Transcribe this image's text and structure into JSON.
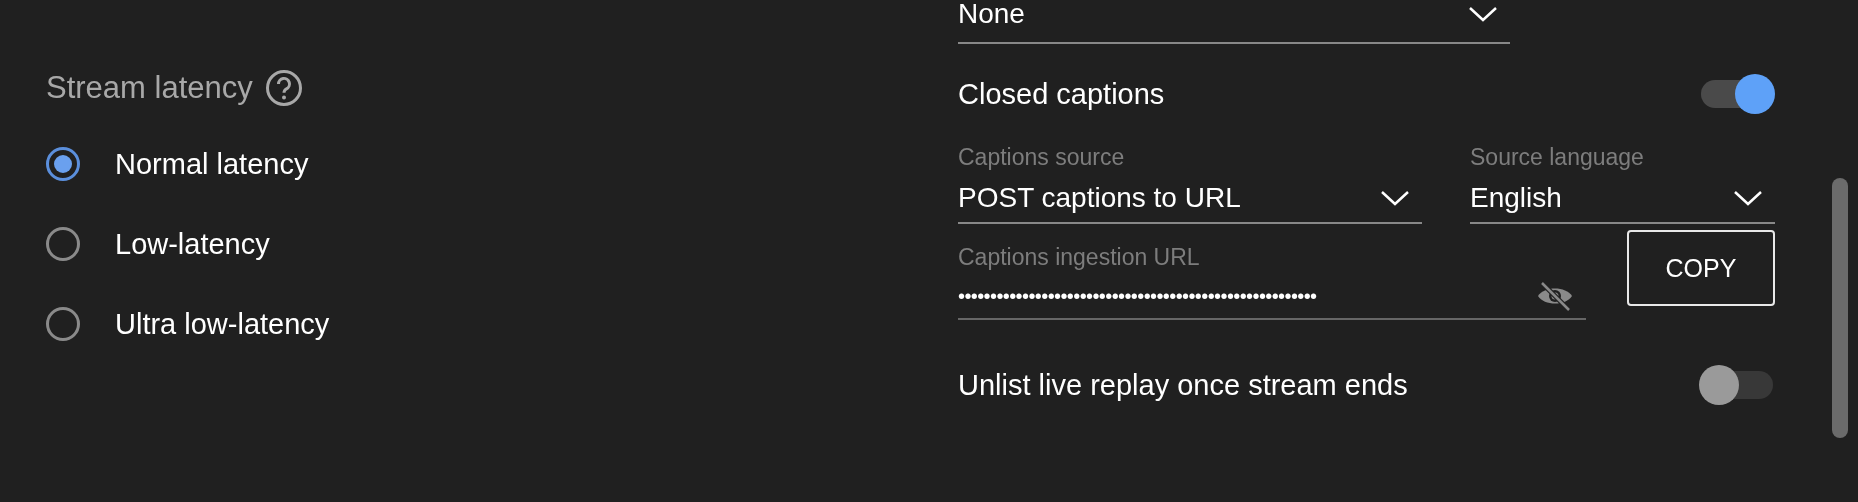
{
  "stream_latency": {
    "title": "Stream latency",
    "options": [
      {
        "label": "Normal latency",
        "selected": true
      },
      {
        "label": "Low-latency",
        "selected": false
      },
      {
        "label": "Ultra low-latency",
        "selected": false
      }
    ]
  },
  "settings": {
    "top_dropdown": {
      "value": "None"
    },
    "closed_captions": {
      "label": "Closed captions",
      "on": true
    },
    "captions_source": {
      "label": "Captions source",
      "value": "POST captions to URL"
    },
    "source_language": {
      "label": "Source language",
      "value": "English"
    },
    "ingestion_url": {
      "label": "Captions ingestion URL",
      "value": "••••••••••••••••••••••••••••••••••••••••••••••••••••••••"
    },
    "copy_button": "COPY",
    "unlist_replay": {
      "label": "Unlist live replay once stream ends",
      "on": false
    }
  }
}
